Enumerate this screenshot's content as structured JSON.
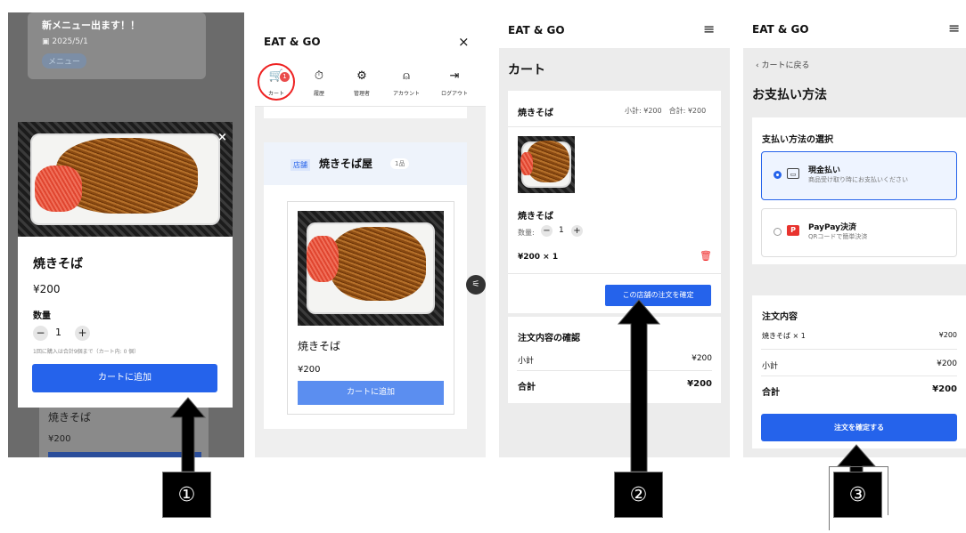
{
  "panel1": {
    "bg_card_title": "新メニュー出ます！！",
    "bg_card_date": "2025/5/1",
    "bg_card_tag": "メニュー",
    "modal": {
      "item_name": "焼きそば",
      "price": "¥200",
      "quantity_label": "数量",
      "minus": "−",
      "quantity": "1",
      "plus": "+",
      "note": "1回に購入は合計9個まで（カート内: 0 個）",
      "add_button": "カートに追加",
      "close": "×"
    },
    "under_item_name": "焼きそば",
    "under_item_price": "¥200"
  },
  "panel2": {
    "app_title": "EAT & GO",
    "close": "×",
    "nav": [
      {
        "icon": "🛒",
        "label": "カート"
      },
      {
        "icon": "⏱",
        "label": "履歴"
      },
      {
        "icon": "⚙",
        "label": "管理者"
      },
      {
        "icon": "⍝",
        "label": "アカウント"
      },
      {
        "icon": "⇥",
        "label": "ログアウト"
      }
    ],
    "cart_badge": "1",
    "shop_tag": "店舗",
    "shop_name": "焼きそば屋",
    "shop_count": "1品",
    "item_name": "焼きそば",
    "item_price": "¥200",
    "add_button": "カートに追加"
  },
  "panel3": {
    "app_title": "EAT & GO",
    "menu": "≡",
    "heading": "カート",
    "shop_name": "焼きそば",
    "subtotal_total": "小計: ¥200　合計: ¥200",
    "item_name": "焼きそば",
    "quantity_label": "数量:",
    "minus": "−",
    "quantity": "1",
    "plus": "+",
    "line": "¥200 × 1",
    "trash": "🗑",
    "confirm_button": "この店舗の注文を確定",
    "summary_heading": "注文内容の確認",
    "subtotal_label": "小計",
    "subtotal_value": "¥200",
    "total_label": "合計",
    "total_value": "¥200"
  },
  "panel4": {
    "app_title": "EAT & GO",
    "menu": "≡",
    "back": "‹ カートに戻る",
    "heading": "お支払い方法",
    "payment_heading": "支払い方法の選択",
    "cash_title": "現金払い",
    "cash_desc": "商品受け取り時にお支払いください",
    "paypay_title": "PayPay決済",
    "paypay_desc": "QRコードで簡単決済",
    "paypay_icon": "P",
    "cash_icon": "▭",
    "order_heading": "注文内容",
    "order_item": "焼きそば × 1",
    "order_item_price": "¥200",
    "subtotal_label": "小計",
    "subtotal_value": "¥200",
    "total_label": "合計",
    "total_value": "¥200",
    "place_order_button": "注文を確定する"
  },
  "steps": [
    "①",
    "②",
    "③"
  ],
  "colors": {
    "primary": "#2563eb",
    "danger": "#e22222"
  }
}
